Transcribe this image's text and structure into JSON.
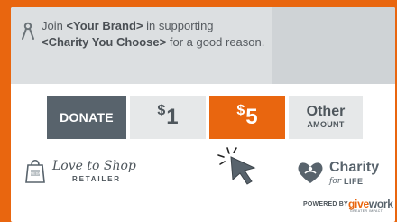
{
  "banner": {
    "text_prefix": "Join ",
    "brand": "<Your Brand>",
    "text_middle": " in supporting",
    "charity": "<Charity You Choose>",
    "text_suffix": " for a good reason."
  },
  "buttons": {
    "donate": "DONATE",
    "one_currency": "$",
    "one_amount": "1",
    "five_currency": "$",
    "five_amount": "5",
    "other_top": "Other",
    "other_bottom": "AMOUNT",
    "selected": "5"
  },
  "retailer": {
    "name": "Love to Shop",
    "sub": "RETAILER",
    "bag_text": "ONE DAY"
  },
  "charity": {
    "name": "Charity",
    "for": "for",
    "life": "LIFE"
  },
  "powered": {
    "label": "POWERED BY",
    "brand_a": "give",
    "brand_b": "work",
    "tagline": "GREATER IMPACT"
  },
  "colors": {
    "accent": "#e9660f",
    "dark": "#58636c",
    "light_button": "#e6e8e9",
    "banner": "#dcdfe1"
  },
  "icons": [
    "ribbon-icon",
    "cursor-click-icon",
    "shopping-bag-icon",
    "heart-hands-icon"
  ]
}
